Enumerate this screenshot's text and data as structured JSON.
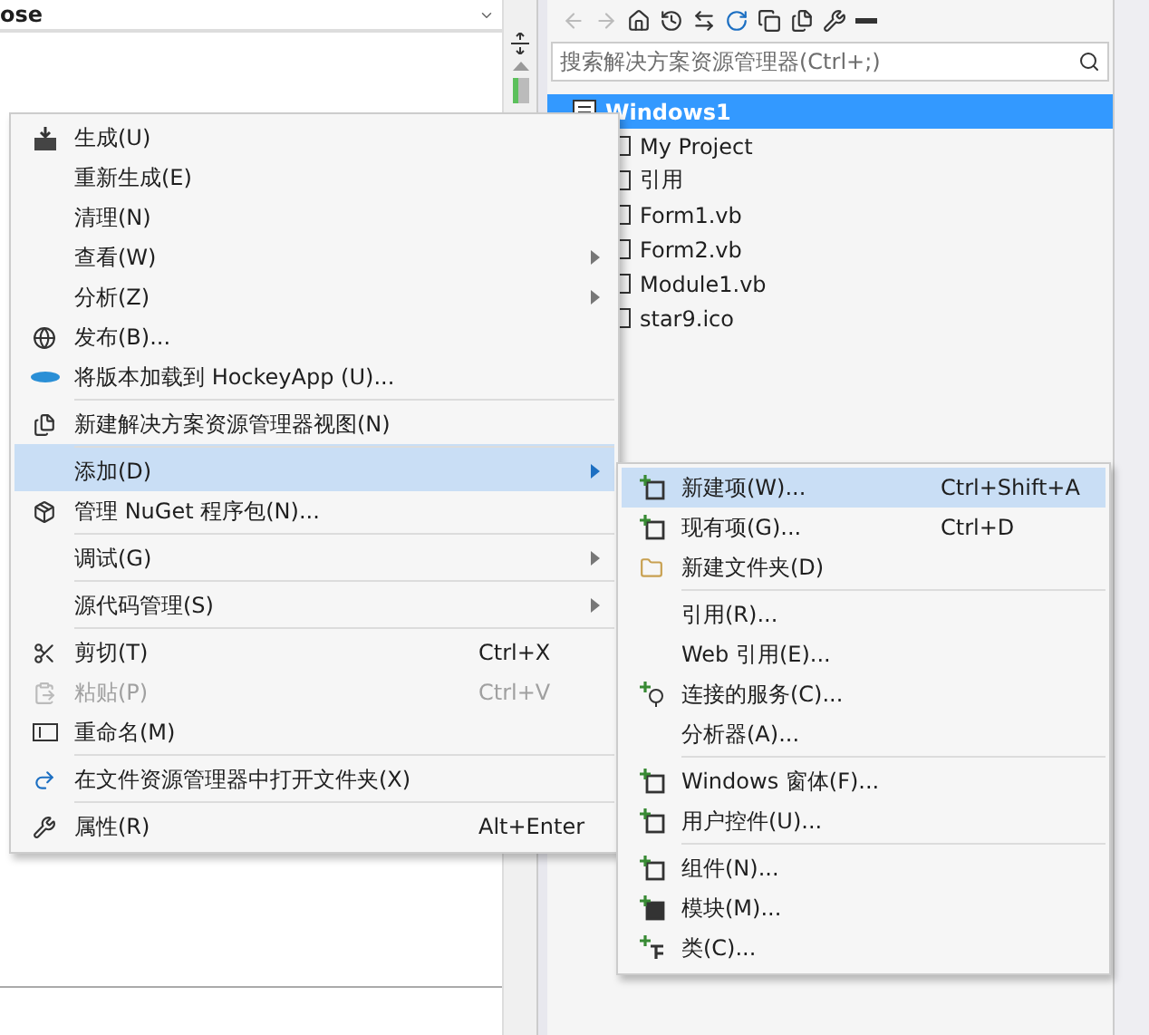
{
  "editor": {
    "dropdown": "ose"
  },
  "solution_explorer": {
    "search": {
      "placeholder": "搜索解决方案资源管理器(Ctrl+;)"
    },
    "tree": [
      {
        "label": "Windows1",
        "selected": true,
        "children": [
          {
            "label": "My Project",
            "selected": false
          },
          {
            "label": "引用",
            "selected": false
          },
          {
            "label": "Form1.vb",
            "selected": false
          },
          {
            "label": "Form2.vb",
            "selected": false
          },
          {
            "label": "Module1.vb",
            "selected": false
          },
          {
            "label": "star9.ico",
            "selected": false
          }
        ]
      }
    ]
  },
  "context_menu": {
    "items": [
      {
        "label": "生成(U)",
        "separator_before": false,
        "selected": false,
        "disabled": false,
        "submenu": false
      },
      {
        "label": "重新生成(E)",
        "separator_before": false,
        "selected": false,
        "disabled": false,
        "submenu": false
      },
      {
        "label": "清理(N)",
        "separator_before": false,
        "selected": false,
        "disabled": false,
        "submenu": false
      },
      {
        "label": "查看(W)",
        "separator_before": false,
        "selected": false,
        "disabled": false,
        "submenu": true
      },
      {
        "label": "分析(Z)",
        "separator_before": false,
        "selected": false,
        "disabled": false,
        "submenu": true
      },
      {
        "label": "发布(B)...",
        "separator_before": false,
        "selected": false,
        "disabled": false,
        "submenu": false
      },
      {
        "label": "将版本加载到 HockeyApp (U)...",
        "separator_before": false,
        "selected": false,
        "disabled": false,
        "submenu": false
      },
      {
        "label": "新建解决方案资源管理器视图(N)",
        "separator_before": true,
        "selected": false,
        "disabled": false,
        "submenu": false
      },
      {
        "label": "添加(D)",
        "separator_before": true,
        "selected": true,
        "disabled": false,
        "submenu": true
      },
      {
        "label": "管理 NuGet 程序包(N)...",
        "separator_before": false,
        "selected": false,
        "disabled": false,
        "submenu": false
      },
      {
        "label": "调试(G)",
        "separator_before": true,
        "selected": false,
        "disabled": false,
        "submenu": true
      },
      {
        "label": "源代码管理(S)",
        "separator_before": true,
        "selected": false,
        "disabled": false,
        "submenu": true
      },
      {
        "label": "剪切(T)",
        "shortcut": "Ctrl+X",
        "separator_before": true,
        "selected": false,
        "disabled": false,
        "submenu": false
      },
      {
        "label": "粘贴(P)",
        "shortcut": "Ctrl+V",
        "separator_before": false,
        "selected": false,
        "disabled": true,
        "submenu": false
      },
      {
        "label": "重命名(M)",
        "separator_before": false,
        "selected": false,
        "disabled": false,
        "submenu": false
      },
      {
        "label": "在文件资源管理器中打开文件夹(X)",
        "separator_before": true,
        "selected": false,
        "disabled": false,
        "submenu": false
      },
      {
        "label": "属性(R)",
        "shortcut": "Alt+Enter",
        "separator_before": true,
        "selected": false,
        "disabled": false,
        "submenu": false
      }
    ]
  },
  "add_submenu": {
    "items": [
      {
        "label": "新建项(W)...",
        "shortcut": "Ctrl+Shift+A",
        "separator_before": false,
        "selected": true
      },
      {
        "label": "现有项(G)...",
        "shortcut": "Ctrl+D",
        "separator_before": false,
        "selected": false
      },
      {
        "label": "新建文件夹(D)",
        "separator_before": false,
        "selected": false
      },
      {
        "label": "引用(R)...",
        "separator_before": true,
        "selected": false
      },
      {
        "label": "Web 引用(E)...",
        "separator_before": false,
        "selected": false
      },
      {
        "label": "连接的服务(C)...",
        "separator_before": false,
        "selected": false
      },
      {
        "label": "分析器(A)...",
        "separator_before": false,
        "selected": false
      },
      {
        "label": "Windows 窗体(F)...",
        "separator_before": true,
        "selected": false
      },
      {
        "label": "用户控件(U)...",
        "separator_before": false,
        "selected": false
      },
      {
        "label": "组件(N)...",
        "separator_before": true,
        "selected": false
      },
      {
        "label": "模块(M)...",
        "separator_before": false,
        "selected": false
      },
      {
        "label": "类(C)...",
        "separator_before": false,
        "selected": false
      }
    ]
  }
}
